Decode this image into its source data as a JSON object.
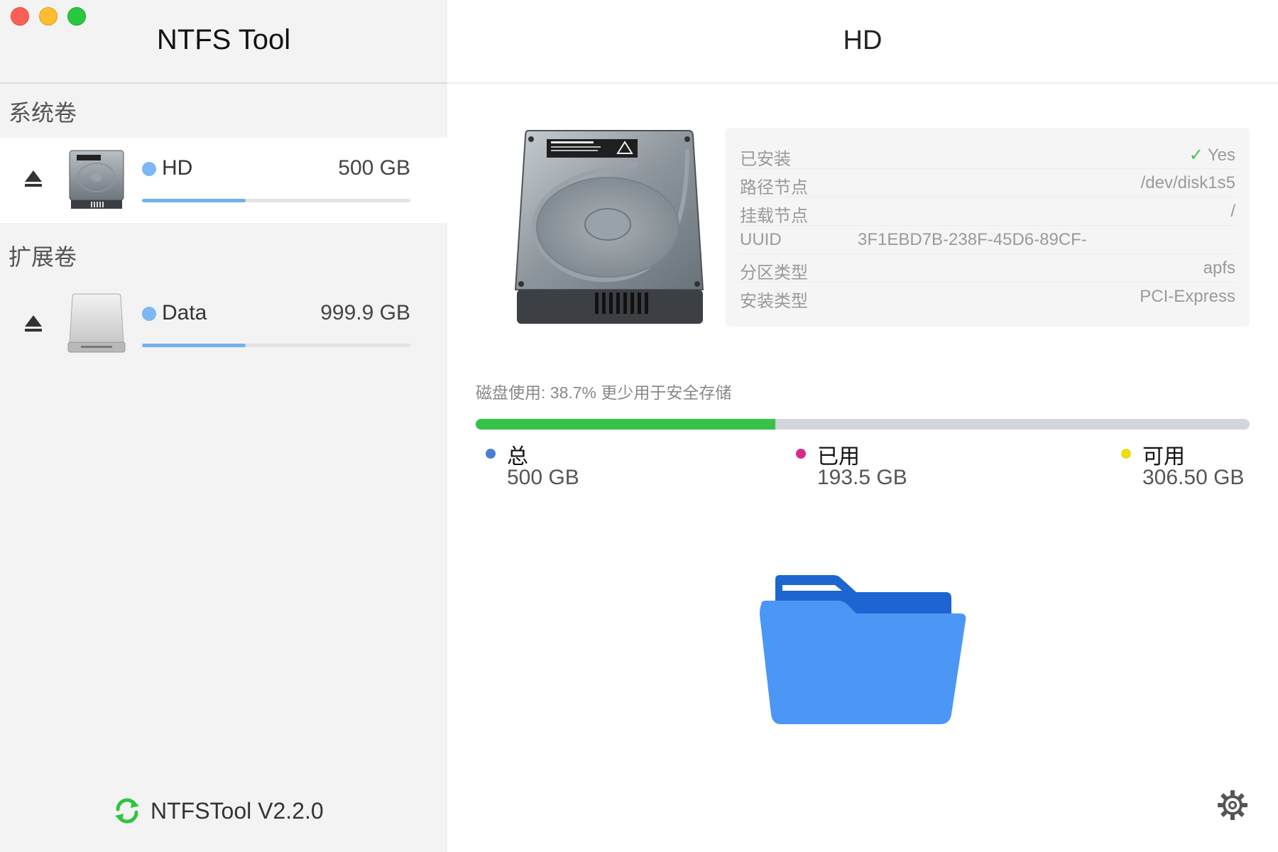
{
  "app": {
    "title": "NTFS Tool",
    "version": "NTFSTool V2.2.0"
  },
  "sidebar": {
    "sections": [
      {
        "label": "系统卷",
        "volumes": [
          {
            "name": "HD",
            "size": "500 GB",
            "used_fraction": 0.387,
            "icon": "internal-hard-disk-icon",
            "selected": true
          }
        ]
      },
      {
        "label": "扩展卷",
        "volumes": [
          {
            "name": "Data",
            "size": "999.9 GB",
            "used_fraction": 0.387,
            "icon": "external-drive-icon",
            "selected": false
          }
        ]
      }
    ]
  },
  "main": {
    "title": "HD",
    "info": {
      "installed": {
        "key": "已安装",
        "value": "Yes"
      },
      "device_node": {
        "key": "路径节点",
        "value": "/dev/disk1s5"
      },
      "mount_point": {
        "key": "挂载节点",
        "value": "/"
      },
      "uuid": {
        "key": "UUID",
        "value": "3F1EBD7B-238F-45D6-89CF-"
      },
      "partition_type": {
        "key": "分区类型",
        "value": "apfs"
      },
      "install_type": {
        "key": "安装类型",
        "value": "PCI-Express"
      }
    },
    "usage": {
      "text": "磁盘使用: 38.7% 更少用于安全存储",
      "used_fraction": 0.387,
      "legend": [
        {
          "label": "总",
          "value": "500 GB",
          "color": "#4a7fd6"
        },
        {
          "label": "已用",
          "value": "193.5 GB",
          "color": "#d6288f"
        },
        {
          "label": "可用",
          "value": "306.50 GB",
          "color": "#e8e010"
        }
      ]
    }
  },
  "colors": {
    "accent": "#6fb0f2",
    "usage_green": "#35c24a",
    "folder_blue": "#4a97f5"
  }
}
